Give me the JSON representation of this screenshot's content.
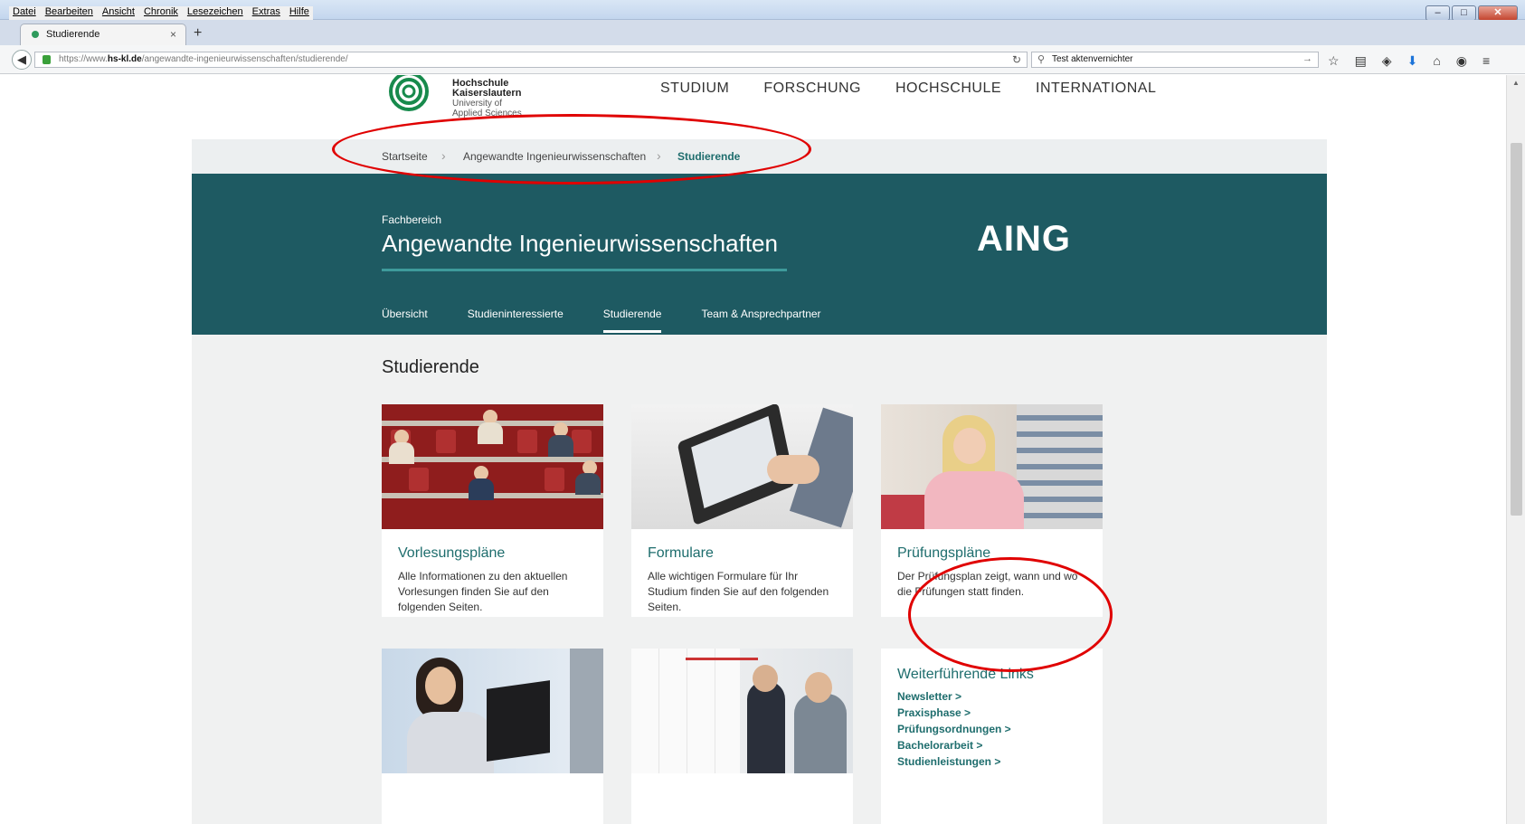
{
  "browser": {
    "menu": [
      "Datei",
      "Bearbeiten",
      "Ansicht",
      "Chronik",
      "Lesezeichen",
      "Extras",
      "Hilfe"
    ],
    "tab_title": "Studierende",
    "new_tab": "+",
    "url_prefix": "https://www.",
    "url_host": "hs-kl.de",
    "url_path": "/angewandte-ingenieurwissenschaften/studierende/",
    "search_value": "Test aktenvernichter"
  },
  "site": {
    "logo_line1": "Hochschule",
    "logo_line2": "Kaiserslautern",
    "logo_line3": "University of",
    "logo_line4": "Applied Sciences",
    "nav": [
      "STUDIUM",
      "FORSCHUNG",
      "HOCHSCHULE",
      "INTERNATIONAL"
    ],
    "breadcrumb": [
      "Startseite",
      "Angewandte Ingenieurwissenschaften",
      "Studierende"
    ],
    "hero": {
      "kicker": "Fachbereich",
      "title": "Angewandte Ingenieurwissenschaften",
      "abbr": "AING",
      "subnav": [
        "Übersicht",
        "Studieninteressierte",
        "Studierende",
        "Team & Ansprechpartner"
      ],
      "subnav_active": "Studierende"
    },
    "section_title": "Studierende",
    "cards": [
      {
        "title": "Vorlesungspläne",
        "text": "Alle Informationen zu den aktuellen Vorlesungen finden Sie auf den folgenden Seiten."
      },
      {
        "title": "Formulare",
        "text": "Alle wichtigen Formulare für Ihr Studium finden Sie auf den folgenden Seiten."
      },
      {
        "title": "Prüfungspläne",
        "text": "Der Prüfungsplan zeigt, wann und wo die Prüfungen statt finden."
      }
    ],
    "links_card": {
      "title": "Weiterführende Links",
      "items": [
        "Newsletter >",
        "Praxisphase >",
        "Prüfungsordnungen >",
        "Bachelorarbeit >",
        "Studienleistungen >"
      ]
    }
  },
  "colors": {
    "hero_bg": "#1e5a62",
    "accent": "#1e6d6d",
    "annotation": "#e00000"
  }
}
